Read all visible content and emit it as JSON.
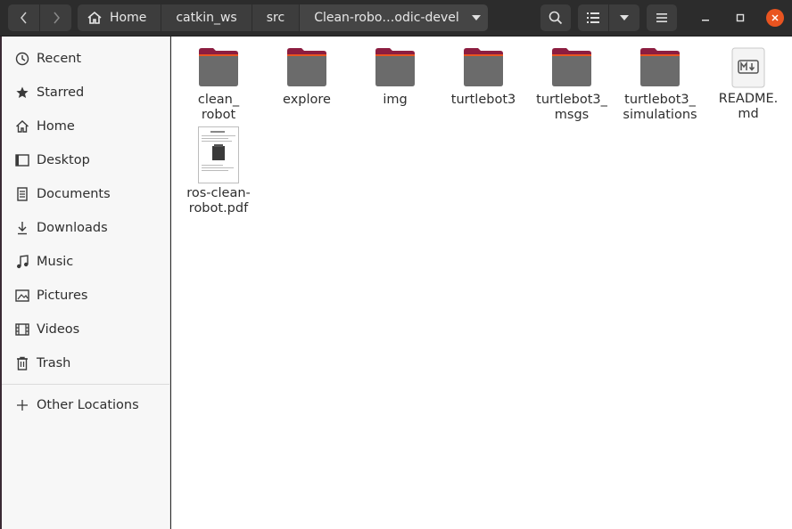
{
  "header": {
    "breadcrumbs": [
      "Home",
      "catkin_ws",
      "src",
      "Clean-robo…odic-devel"
    ]
  },
  "sidebar": {
    "items": [
      {
        "label": "Recent",
        "icon": "clock-icon"
      },
      {
        "label": "Starred",
        "icon": "star-icon"
      },
      {
        "label": "Home",
        "icon": "home-icon"
      },
      {
        "label": "Desktop",
        "icon": "desktop-icon"
      },
      {
        "label": "Documents",
        "icon": "documents-icon"
      },
      {
        "label": "Downloads",
        "icon": "downloads-icon"
      },
      {
        "label": "Music",
        "icon": "music-icon"
      },
      {
        "label": "Pictures",
        "icon": "pictures-icon"
      },
      {
        "label": "Videos",
        "icon": "videos-icon"
      },
      {
        "label": "Trash",
        "icon": "trash-icon"
      }
    ],
    "other_locations": "Other Locations"
  },
  "files": [
    {
      "name": "clean_\nrobot",
      "type": "folder"
    },
    {
      "name": "explore",
      "type": "folder"
    },
    {
      "name": "img",
      "type": "folder"
    },
    {
      "name": "turtlebot3",
      "type": "folder"
    },
    {
      "name": "turtlebot3_\nmsgs",
      "type": "folder"
    },
    {
      "name": "turtlebot3_\nsimulations",
      "type": "folder"
    },
    {
      "name": "README.\nmd",
      "type": "markdown"
    },
    {
      "name": "ros-clean-\nrobot.pdf",
      "type": "pdf"
    }
  ],
  "colors": {
    "accent": "#e95420",
    "folder_tab": "#8c1d40",
    "folder_body": "#6b6b6b"
  }
}
